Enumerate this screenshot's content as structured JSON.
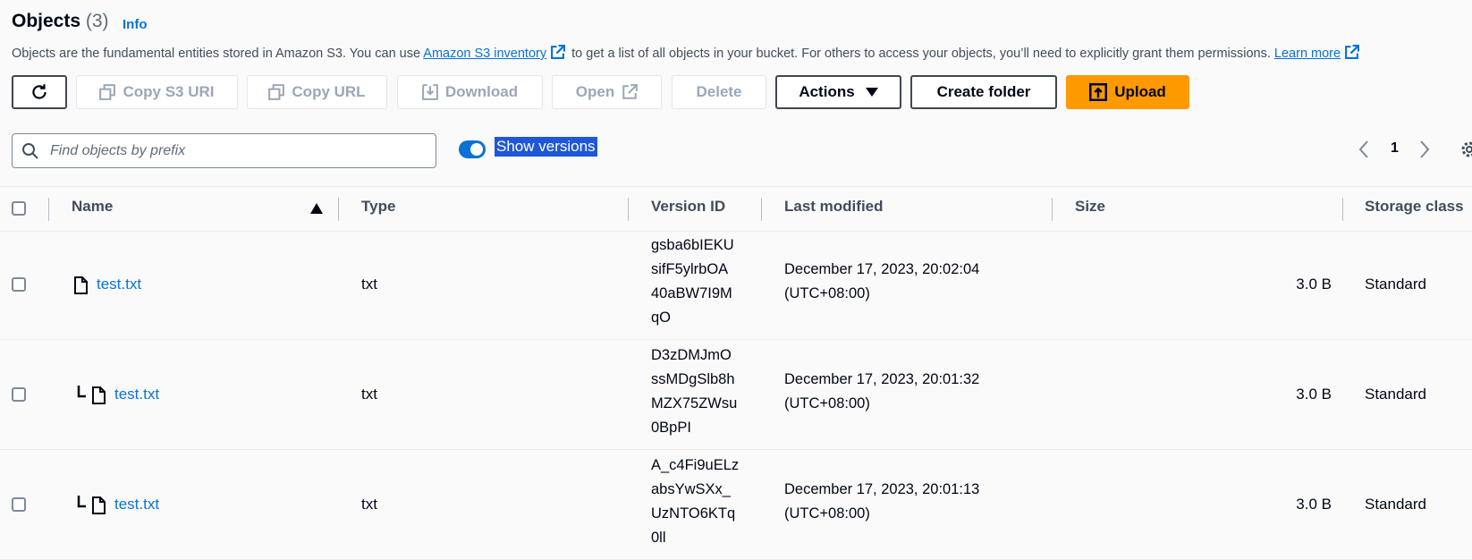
{
  "header": {
    "title": "Objects",
    "count": "(3)",
    "info": "Info",
    "desc_part1": "Objects are the fundamental entities stored in Amazon S3. You can use ",
    "inventory_link": "Amazon S3 inventory",
    "desc_part2": " to get a list of all objects in your bucket. For others to access your objects, you’ll need to explicitly grant them permissions. ",
    "learn_more": "Learn more"
  },
  "toolbar": {
    "copy_s3_uri": "Copy S3 URI",
    "copy_url": "Copy URL",
    "download": "Download",
    "open": "Open",
    "delete": "Delete",
    "actions": "Actions",
    "create_folder": "Create folder",
    "upload": "Upload"
  },
  "search": {
    "placeholder": "Find objects by prefix"
  },
  "show_versions": {
    "label": "Show versions",
    "on": true
  },
  "pagination": {
    "page": "1"
  },
  "table": {
    "columns": [
      "Name",
      "Type",
      "Version ID",
      "Last modified",
      "Size",
      "Storage class"
    ],
    "sort": "Name ascending",
    "rows": [
      {
        "name": "test.txt",
        "type": "txt",
        "version_id": [
          "gsba6bIEKU",
          "sifF5ylrbOA",
          "40aBW7I9M",
          "qO"
        ],
        "modified": [
          "December 17, 2023, 20:02:04",
          "(UTC+08:00)"
        ],
        "size": "3.0 B",
        "storage": "Standard",
        "nested": false
      },
      {
        "name": "test.txt",
        "type": "txt",
        "version_id": [
          "D3zDMJmO",
          "ssMDgSlb8h",
          "MZX75ZWsu",
          "0BpPI"
        ],
        "modified": [
          "December 17, 2023, 20:01:32",
          "(UTC+08:00)"
        ],
        "size": "3.0 B",
        "storage": "Standard",
        "nested": true
      },
      {
        "name": "test.txt",
        "type": "txt",
        "version_id": [
          "A_c4Fi9uELz",
          "absYwSXx_",
          "UzNTO6KTq",
          "0ll"
        ],
        "modified": [
          "December 17, 2023, 20:01:13",
          "(UTC+08:00)"
        ],
        "size": "3.0 B",
        "storage": "Standard",
        "nested": true
      }
    ]
  },
  "colors": {
    "accent": "#0972d3",
    "primary_button": "#ff9900",
    "selection": "#1f57d8"
  }
}
